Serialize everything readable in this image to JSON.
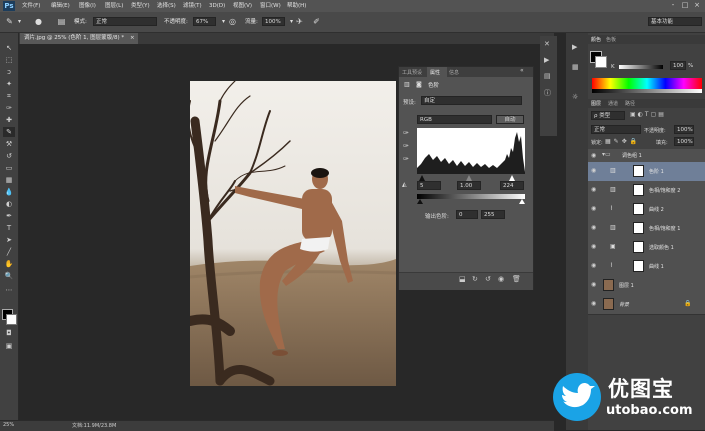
{
  "app": {
    "logo": "Ps"
  },
  "menu": [
    "文件(F)",
    "编辑(E)",
    "图像(I)",
    "图层(L)",
    "类型(Y)",
    "选择(S)",
    "滤镜(T)",
    "3D(D)",
    "视图(V)",
    "窗口(W)",
    "帮助(H)"
  ],
  "window_controls": [
    "-",
    "□",
    "×"
  ],
  "options": {
    "mode_label": "模式:",
    "mode_value": "正常",
    "opacity_label": "不透明度:",
    "opacity_value": "67%",
    "flow_label": "流量:",
    "flow_value": "100%",
    "workspace": "基本功能"
  },
  "doc_tab": {
    "title": "调片.jpg @ 25% (色阶 1, 图层蒙版/8) *",
    "close": "×"
  },
  "properties": {
    "tabs": [
      "工具预设",
      "属性",
      "信息"
    ],
    "adjustment_name": "色阶",
    "preset_label": "预设:",
    "preset_value": "自定",
    "channel_value": "RGB",
    "auto_button": "自动",
    "input_black": "5",
    "input_gamma": "1.00",
    "input_white": "224",
    "output_label": "输出色阶:",
    "output_black": "0",
    "output_white": "255",
    "collapse": "«"
  },
  "color_panel": {
    "tabs": [
      "颜色",
      "色板"
    ],
    "k_label": "K",
    "k_value": "100",
    "k_unit": "%"
  },
  "layers_panel": {
    "tabs": [
      "图层",
      "通道",
      "路径"
    ],
    "filter_kind": "ρ 类型",
    "blend_mode": "正常",
    "opacity_label": "不透明度:",
    "opacity_value": "100%",
    "lock_label": "锁定:",
    "fill_label": "填充:",
    "fill_value": "100%",
    "group": "调色组 1",
    "layers": [
      "色阶 1",
      "色相/饱和度 2",
      "曲线 2",
      "色相/饱和度 1",
      "选取颜色 1",
      "曲线 1",
      "图层 1",
      "背景"
    ]
  },
  "status": {
    "zoom": "25%",
    "doc": "文档:11.9M/23.8M"
  },
  "watermark": {
    "cn": "优图宝",
    "url": "utobao.com"
  },
  "colors": {
    "accent": "#1aa3e6",
    "selected_layer": "#6f7f98"
  }
}
